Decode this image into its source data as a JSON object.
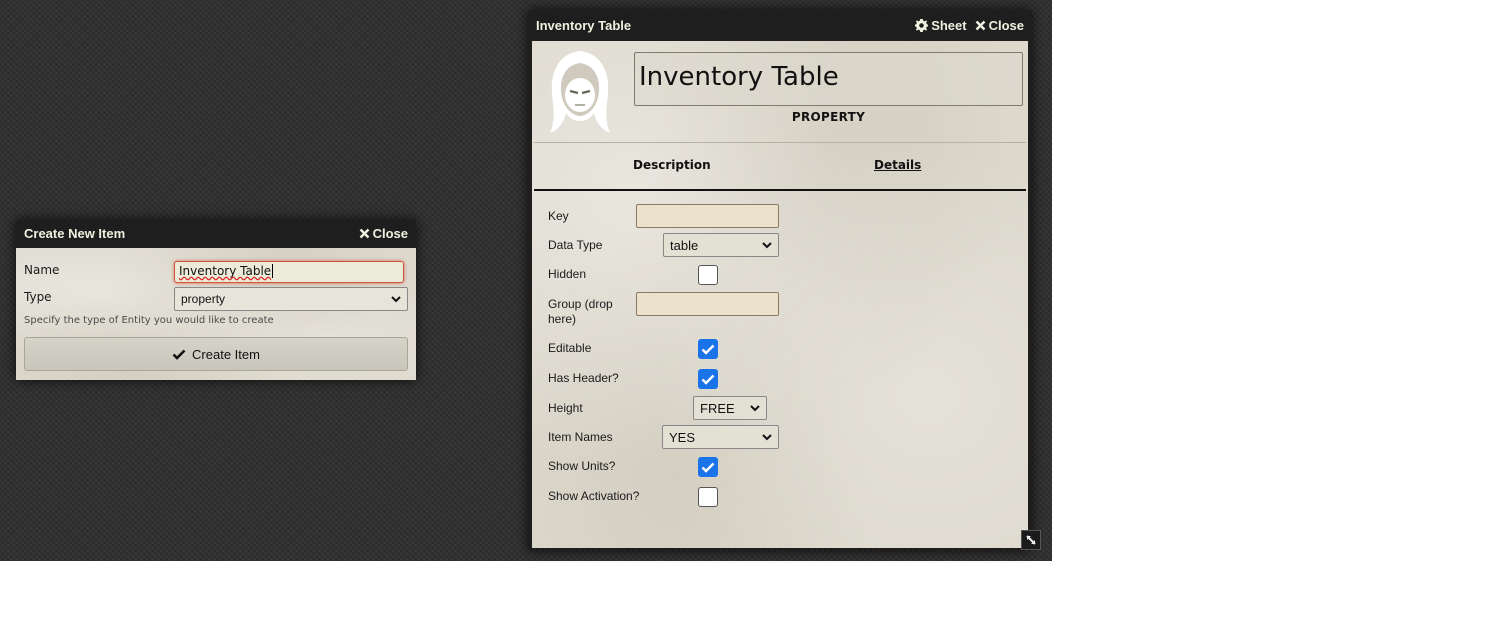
{
  "create_dialog": {
    "title": "Create New Item",
    "close_label": "Close",
    "name_label": "Name",
    "name_value": "Inventory Table",
    "type_label": "Type",
    "type_value": "property",
    "hint": "Specify the type of Entity you would like to create",
    "create_button": "Create Item"
  },
  "sheet": {
    "title": "Inventory Table",
    "sheet_label": "Sheet",
    "close_label": "Close",
    "item_name": "Inventory Table",
    "item_type": "PROPERTY",
    "tabs": [
      "Description",
      "Details"
    ],
    "fields": {
      "key_label": "Key",
      "key_value": "",
      "data_type_label": "Data Type",
      "data_type_value": "table",
      "hidden_label": "Hidden",
      "hidden_checked": false,
      "group_label": "Group (drop here)",
      "group_value": "",
      "editable_label": "Editable",
      "editable_checked": true,
      "has_header_label": "Has Header?",
      "has_header_checked": true,
      "height_label": "Height",
      "height_value": "FREE",
      "item_names_label": "Item Names",
      "item_names_value": "YES",
      "show_units_label": "Show Units?",
      "show_units_checked": true,
      "show_activation_label": "Show Activation?",
      "show_activation_checked": false
    }
  },
  "icons": [
    "close-icon",
    "gear-icon",
    "check-icon",
    "chevron-down-icon",
    "hooded-figure-icon",
    "resize-icon"
  ],
  "colors": {
    "accent_checkbox": "#1a73e8",
    "header_bg": "#1e1e1e",
    "parchment": "#dcd8cc"
  }
}
